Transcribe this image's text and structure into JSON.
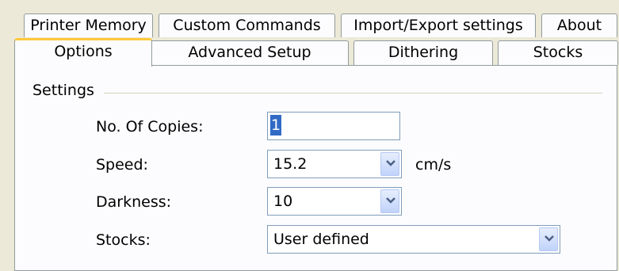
{
  "tabs_row1": [
    "Printer Memory",
    "Custom Commands",
    "Import/Export settings",
    "About"
  ],
  "tabs_row2": [
    "Options",
    "Advanced Setup",
    "Dithering",
    "Stocks"
  ],
  "active_tab": "Options",
  "group": {
    "label": "Settings"
  },
  "fields": {
    "copies": {
      "label": "No. Of Copies:",
      "value": "1"
    },
    "speed": {
      "label": "Speed:",
      "value": "15.2",
      "unit": "cm/s"
    },
    "darkness": {
      "label": "Darkness:",
      "value": "10"
    },
    "stocks": {
      "label": "Stocks:",
      "value": "User defined"
    }
  },
  "icons": {
    "dropdown": "chevron-down-icon"
  },
  "colors": {
    "selection": "#316ac5",
    "active_tab_accent": "#ffc83c",
    "window_bg": "#ece9d8"
  }
}
